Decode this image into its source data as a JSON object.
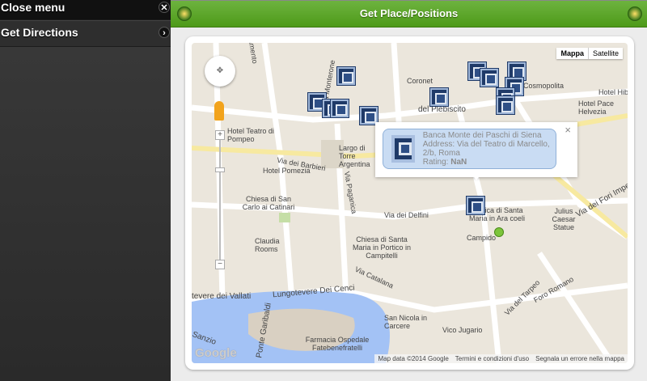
{
  "sidebar": {
    "close_label": "Close menu",
    "directions_label": "Get Directions"
  },
  "header": {
    "title": "Get Place/Positions"
  },
  "map": {
    "type_buttons": [
      "Mappa",
      "Satellite"
    ],
    "labels": [
      "cimento",
      "Via Monterone",
      "Coronet",
      "del Plebiscito",
      "Cosmopolita",
      "Hotel Hib",
      "Hotel Pace Helvezia",
      "Hotel Teatro di Pompeo",
      "Via dei Barbieri",
      "Largo di Torre Argentina",
      "Hotel Pomezia",
      "Chiesa di San Carlo ai Catinari",
      "Via Paganica",
      "Via dei Delfini",
      "Basilica di Santa Maria in Ara coeli",
      "Julius Caesar Statue",
      "Via dei Fori Imperiali",
      "Campido",
      "Claudia Rooms",
      "Chiesa di Santa Maria in Portico in Campitelli",
      "Via Catalana",
      "Lungotevere Dei Cenci",
      "tevere dei Vallati",
      "Ponte Garibaldi",
      "Farmacia Ospedale Fatebenefratelli",
      "San Nicola in Carcere",
      "Vico Jugario",
      "Foro Romano",
      "Via del Tarpeo",
      "Sanzio"
    ],
    "popup": {
      "name": "Banca Monte dei Paschi di Siena",
      "address": "Address: Via del Teatro di Marcello, 2/b, Roma",
      "rating_label": "Rating:",
      "rating_value": "NaN"
    },
    "footer": [
      "Map data ©2014 Google",
      "Termini e condizioni d'uso",
      "Segnala un errore nella mappa"
    ],
    "logo": "Google"
  },
  "colors": {
    "header": "#5aa628",
    "sidebar": "#2e2e2e",
    "marker": "#1f3a68",
    "water": "#a3c2f5"
  }
}
